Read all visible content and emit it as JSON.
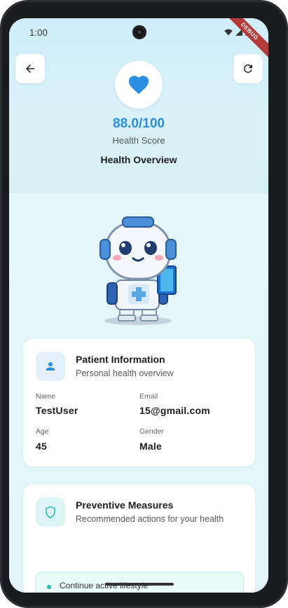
{
  "status_bar": {
    "time": "1:00",
    "debug_badge": "DEBUG"
  },
  "header": {
    "score": "88.0/100",
    "score_label": "Health Score",
    "title": "Health Overview",
    "accent_color": "#2b8ee0"
  },
  "patient_card": {
    "title": "Patient Information",
    "subtitle": "Personal health overview",
    "fields": [
      {
        "label": "Name",
        "value": "TestUser"
      },
      {
        "label": "Email",
        "value": "15@gmail.com"
      },
      {
        "label": "Age",
        "value": "45"
      },
      {
        "label": "Gender",
        "value": "Male"
      }
    ]
  },
  "preventive_card": {
    "title": "Preventive Measures",
    "subtitle": "Recommended actions for your health",
    "items": [
      "Continue active lifestyle"
    ]
  },
  "icons": {
    "back": "arrow-left-icon",
    "refresh": "refresh-icon",
    "heart": "heart-icon",
    "person": "person-icon",
    "shield": "shield-icon"
  }
}
